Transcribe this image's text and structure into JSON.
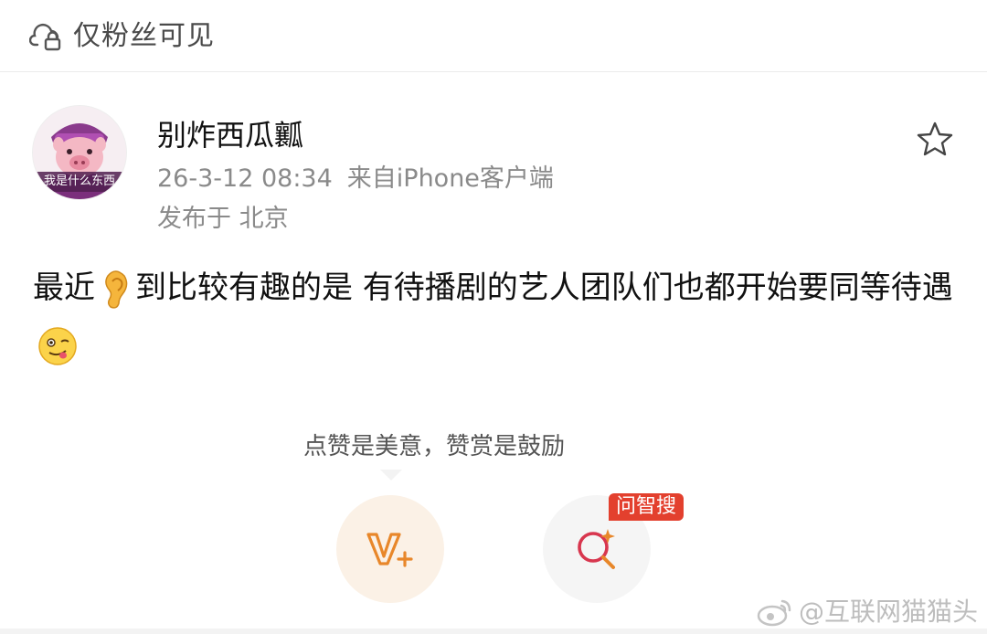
{
  "visibility": {
    "label": "仅粉丝可见",
    "icon": "lock-cloud-icon"
  },
  "post": {
    "author": {
      "name": "别炸西瓜瓤",
      "avatar_caption": "我是什么东西"
    },
    "meta": {
      "time": "26-3-12 08:34",
      "source": "来自iPhone客户端"
    },
    "location": "发布于 北京",
    "favorite_icon": "star-outline-icon",
    "content": {
      "part1": "最近",
      "part2": "到比较有趣的是 有待播剧的艺人团队们也都开始要同等待遇",
      "emoji1": "ear-emoji",
      "emoji2": "yum-face-emoji"
    }
  },
  "reward": {
    "tip": "点赞是美意，赞赏是鼓励",
    "reward_icon": "v-plus-icon",
    "search_icon": "ai-search-icon",
    "search_badge": "问智搜"
  },
  "watermark": {
    "text": "@互联网猫猫头"
  },
  "colors": {
    "accent_orange": "#e8872a",
    "badge_red": "#e3402e",
    "text_gray": "#8a8a8a"
  }
}
